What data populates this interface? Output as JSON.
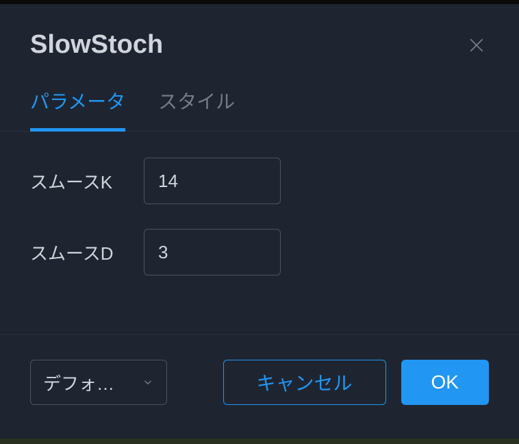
{
  "dialog": {
    "title": "SlowStoch"
  },
  "tabs": {
    "parameters": "パラメータ",
    "style": "スタイル"
  },
  "fields": {
    "smoothK": {
      "label": "スムースK",
      "value": "14"
    },
    "smoothD": {
      "label": "スムースD",
      "value": "3"
    }
  },
  "footer": {
    "dropdown_label": "デフォ…",
    "cancel": "キャンセル",
    "ok": "OK"
  }
}
